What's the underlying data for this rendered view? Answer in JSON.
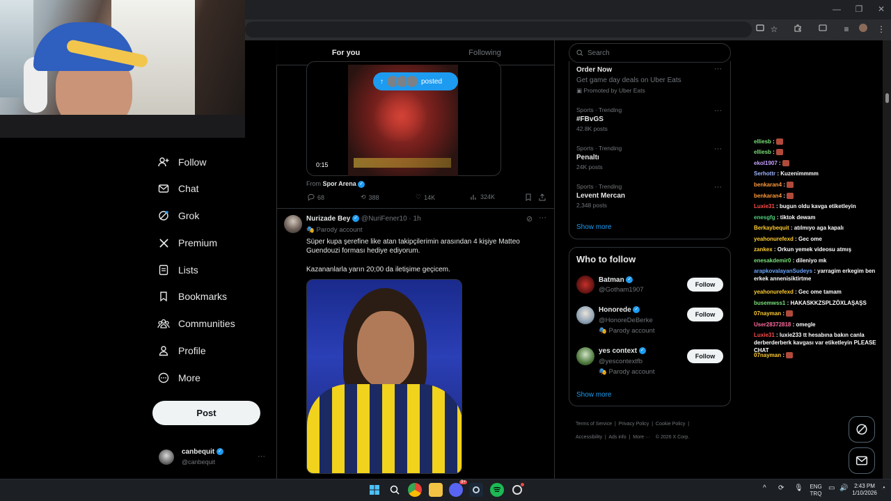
{
  "browser": {
    "window_controls": [
      "—",
      "❐",
      "✕"
    ]
  },
  "nav": {
    "items": [
      {
        "label": "Follow",
        "icon": "add-user-icon"
      },
      {
        "label": "Chat",
        "icon": "mail-icon"
      },
      {
        "label": "Grok",
        "icon": "grok-icon"
      },
      {
        "label": "Premium",
        "icon": "x-logo-icon"
      },
      {
        "label": "Lists",
        "icon": "list-icon"
      },
      {
        "label": "Bookmarks",
        "icon": "bookmark-icon"
      },
      {
        "label": "Communities",
        "icon": "communities-icon"
      },
      {
        "label": "Profile",
        "icon": "person-icon"
      },
      {
        "label": "More",
        "icon": "more-circle-icon"
      }
    ],
    "post_label": "Post",
    "account": {
      "name": "canbequit",
      "handle": "@canbequit"
    }
  },
  "feed": {
    "tabs": [
      {
        "label": "For you",
        "active": true
      },
      {
        "label": "Following",
        "active": false
      }
    ],
    "first_tweet": {
      "video_time": "0:15",
      "posted_label": "posted",
      "from_label": "From",
      "from_source": "Spor Arena",
      "replies": "68",
      "reposts": "388",
      "likes": "14K",
      "views": "324K"
    },
    "second_tweet": {
      "name": "Nurizade Bey",
      "handle": "@NuriFener10 · 1h",
      "badge": "Parody account",
      "text_line1": "Süper kupa şerefine like atan takipçilerimin arasından 4 kişiye Matteo",
      "text_line2": "Guendouzi forması hediye ediyorum.",
      "text_line3": "Kazananlarla yarın 20;00 da iletişime geçicem."
    }
  },
  "sidebar": {
    "search_placeholder": "Search",
    "promo": {
      "title": "Order Now",
      "subtitle": "Get game day deals on Uber Eats",
      "promoted": "Promoted by Uber Eats"
    },
    "trends": [
      {
        "category": "Sports · Trending",
        "title": "#FBvGS",
        "count": "42.8K posts"
      },
      {
        "category": "Sports · Trending",
        "title": "Penaltı",
        "count": "24K posts"
      },
      {
        "category": "Sports · Trending",
        "title": "Levent Mercan",
        "count": "2,348 posts"
      }
    ],
    "show_more": "Show more",
    "who_to_follow": {
      "title": "Who to follow",
      "accounts": [
        {
          "name": "Batman",
          "handle": "@Gotham1907",
          "badge": "",
          "button": "Follow"
        },
        {
          "name": "Honorede",
          "handle": "@HonoreDeBerke",
          "badge": "Parody account",
          "button": "Follow"
        },
        {
          "name": "yes context",
          "handle": "@yescontextfb",
          "badge": "Parody account",
          "button": "Follow"
        }
      ],
      "show_more": "Show more"
    },
    "footer": [
      "Terms of Service",
      "Privacy Policy",
      "Cookie Policy",
      "Accessibility",
      "Ads info",
      "More ···",
      "© 2026 X Corp."
    ]
  },
  "chat": {
    "messages": [
      {
        "user": "elliesb",
        "color": "#7ae07a",
        "text": "",
        "emote": true
      },
      {
        "user": "elliesb",
        "color": "#7ae07a",
        "text": "",
        "emote": true
      },
      {
        "user": "ekol1907",
        "color": "#c6a3ff",
        "text": "",
        "emote": true
      },
      {
        "user": "Serhottr",
        "color": "#9fb4ff",
        "text": "Kuzenimmmm",
        "emote": false
      },
      {
        "user": "benkaran4",
        "color": "#ff9a3c",
        "text": "",
        "emote": true
      },
      {
        "user": "benkaran4",
        "color": "#ff9a3c",
        "text": "",
        "emote": true
      },
      {
        "user": "Luxie31",
        "color": "#ff4b4b",
        "text": "bugun oldu kavga etiketleyin",
        "emote": false
      },
      {
        "user": "enesgfg",
        "color": "#4fd17a",
        "text": "tiktok dewam",
        "emote": false
      },
      {
        "user": "Berkaybequit",
        "color": "#ffcc33",
        "text": "atılmıyo aga kapalı",
        "emote": false
      },
      {
        "user": "yeahonurefexd",
        "color": "#ffcc33",
        "text": "Gec ome",
        "emote": false
      },
      {
        "user": "zankex",
        "color": "#ffcc33",
        "text": "Orkun yemek videosu atmış",
        "emote": false
      },
      {
        "user": "enesakdemir0",
        "color": "#7ae07a",
        "text": "dileniyo mk",
        "emote": false
      },
      {
        "user": "arapkovalayanSudeys",
        "color": "#6aa7ff",
        "text": "yarragim erkegim ben erkek annenisiktirtme",
        "emote": false
      },
      {
        "user": "yeahonurefexd",
        "color": "#ffcc33",
        "text": "Gec ome tamam",
        "emote": false
      },
      {
        "user": "busemwss1",
        "color": "#7ae07a",
        "text": "HAKASKKZSPLZÖXLAŞAŞS",
        "emote": false
      },
      {
        "user": "07nayman",
        "color": "#ffcc33",
        "text": "",
        "emote": true
      },
      {
        "user": "User28372818",
        "color": "#ff6b9a",
        "text": "omegle",
        "emote": false
      },
      {
        "user": "Luxie31",
        "color": "#ff4b4b",
        "text": "luxie233 tt hesabına bakın canla derberderberk kavgası var etiketleyin PLEASE CHAT",
        "emote": false
      },
      {
        "user": "07nayman",
        "color": "#ffcc33",
        "text": "",
        "emote": true
      }
    ]
  },
  "taskbar": {
    "lang_top": "ENG",
    "lang_bottom": "TRQ",
    "time": "2:43 PM",
    "date": "1/10/2026",
    "discord_badge": "9+"
  }
}
